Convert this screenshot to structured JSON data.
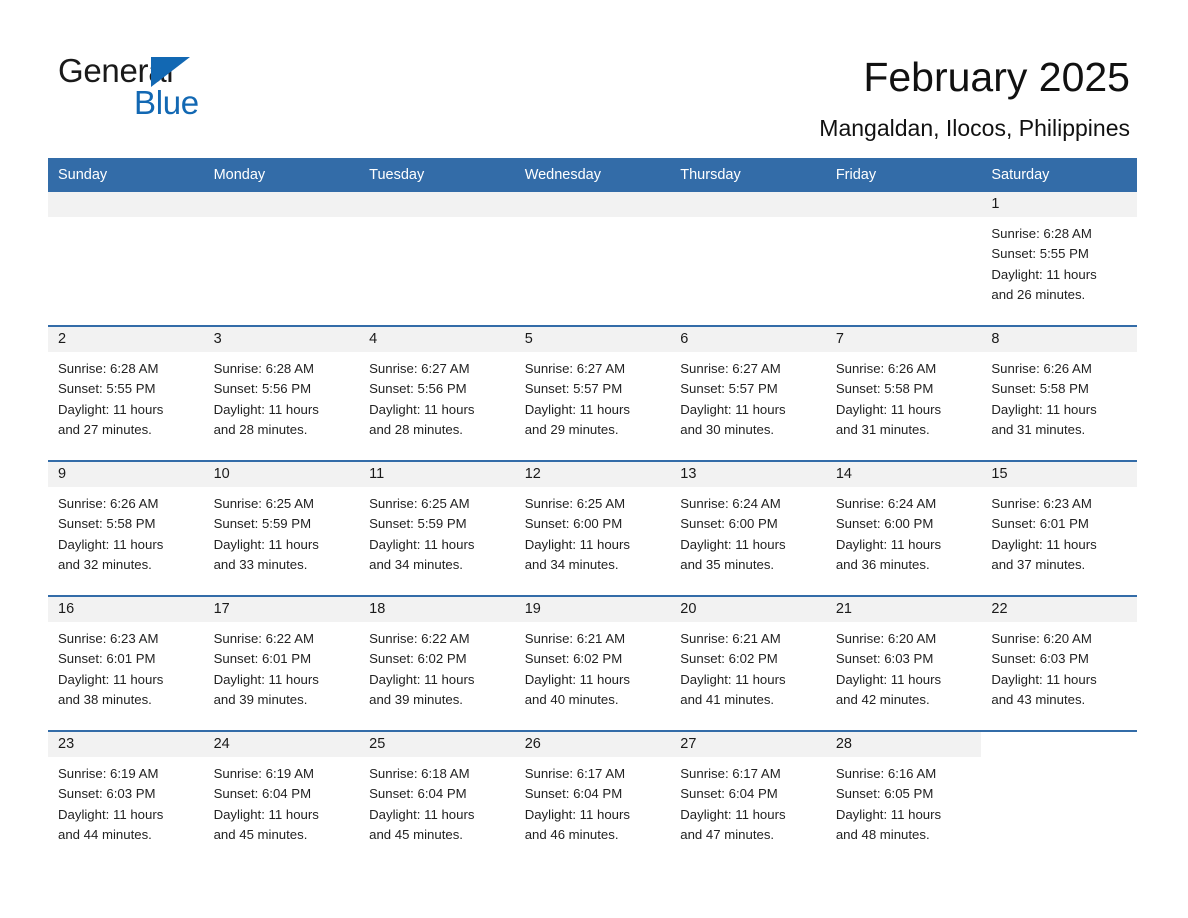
{
  "brand": {
    "name_part1": "General",
    "name_part2": "Blue",
    "accent_color": "#1268b3",
    "triangle_icon": "brand-triangle-icon"
  },
  "header": {
    "title": "February 2025",
    "subtitle": "Mangaldan, Ilocos, Philippines",
    "header_bg_color": "#336ca8"
  },
  "calendar": {
    "weekday_headers": [
      "Sunday",
      "Monday",
      "Tuesday",
      "Wednesday",
      "Thursday",
      "Friday",
      "Saturday"
    ],
    "weeks": [
      [
        {
          "day": "",
          "sunrise": "",
          "sunset": "",
          "daylight1": "",
          "daylight2": ""
        },
        {
          "day": "",
          "sunrise": "",
          "sunset": "",
          "daylight1": "",
          "daylight2": ""
        },
        {
          "day": "",
          "sunrise": "",
          "sunset": "",
          "daylight1": "",
          "daylight2": ""
        },
        {
          "day": "",
          "sunrise": "",
          "sunset": "",
          "daylight1": "",
          "daylight2": ""
        },
        {
          "day": "",
          "sunrise": "",
          "sunset": "",
          "daylight1": "",
          "daylight2": ""
        },
        {
          "day": "",
          "sunrise": "",
          "sunset": "",
          "daylight1": "",
          "daylight2": ""
        },
        {
          "day": "1",
          "sunrise": "Sunrise: 6:28 AM",
          "sunset": "Sunset: 5:55 PM",
          "daylight1": "Daylight: 11 hours",
          "daylight2": "and 26 minutes."
        }
      ],
      [
        {
          "day": "2",
          "sunrise": "Sunrise: 6:28 AM",
          "sunset": "Sunset: 5:55 PM",
          "daylight1": "Daylight: 11 hours",
          "daylight2": "and 27 minutes."
        },
        {
          "day": "3",
          "sunrise": "Sunrise: 6:28 AM",
          "sunset": "Sunset: 5:56 PM",
          "daylight1": "Daylight: 11 hours",
          "daylight2": "and 28 minutes."
        },
        {
          "day": "4",
          "sunrise": "Sunrise: 6:27 AM",
          "sunset": "Sunset: 5:56 PM",
          "daylight1": "Daylight: 11 hours",
          "daylight2": "and 28 minutes."
        },
        {
          "day": "5",
          "sunrise": "Sunrise: 6:27 AM",
          "sunset": "Sunset: 5:57 PM",
          "daylight1": "Daylight: 11 hours",
          "daylight2": "and 29 minutes."
        },
        {
          "day": "6",
          "sunrise": "Sunrise: 6:27 AM",
          "sunset": "Sunset: 5:57 PM",
          "daylight1": "Daylight: 11 hours",
          "daylight2": "and 30 minutes."
        },
        {
          "day": "7",
          "sunrise": "Sunrise: 6:26 AM",
          "sunset": "Sunset: 5:58 PM",
          "daylight1": "Daylight: 11 hours",
          "daylight2": "and 31 minutes."
        },
        {
          "day": "8",
          "sunrise": "Sunrise: 6:26 AM",
          "sunset": "Sunset: 5:58 PM",
          "daylight1": "Daylight: 11 hours",
          "daylight2": "and 31 minutes."
        }
      ],
      [
        {
          "day": "9",
          "sunrise": "Sunrise: 6:26 AM",
          "sunset": "Sunset: 5:58 PM",
          "daylight1": "Daylight: 11 hours",
          "daylight2": "and 32 minutes."
        },
        {
          "day": "10",
          "sunrise": "Sunrise: 6:25 AM",
          "sunset": "Sunset: 5:59 PM",
          "daylight1": "Daylight: 11 hours",
          "daylight2": "and 33 minutes."
        },
        {
          "day": "11",
          "sunrise": "Sunrise: 6:25 AM",
          "sunset": "Sunset: 5:59 PM",
          "daylight1": "Daylight: 11 hours",
          "daylight2": "and 34 minutes."
        },
        {
          "day": "12",
          "sunrise": "Sunrise: 6:25 AM",
          "sunset": "Sunset: 6:00 PM",
          "daylight1": "Daylight: 11 hours",
          "daylight2": "and 34 minutes."
        },
        {
          "day": "13",
          "sunrise": "Sunrise: 6:24 AM",
          "sunset": "Sunset: 6:00 PM",
          "daylight1": "Daylight: 11 hours",
          "daylight2": "and 35 minutes."
        },
        {
          "day": "14",
          "sunrise": "Sunrise: 6:24 AM",
          "sunset": "Sunset: 6:00 PM",
          "daylight1": "Daylight: 11 hours",
          "daylight2": "and 36 minutes."
        },
        {
          "day": "15",
          "sunrise": "Sunrise: 6:23 AM",
          "sunset": "Sunset: 6:01 PM",
          "daylight1": "Daylight: 11 hours",
          "daylight2": "and 37 minutes."
        }
      ],
      [
        {
          "day": "16",
          "sunrise": "Sunrise: 6:23 AM",
          "sunset": "Sunset: 6:01 PM",
          "daylight1": "Daylight: 11 hours",
          "daylight2": "and 38 minutes."
        },
        {
          "day": "17",
          "sunrise": "Sunrise: 6:22 AM",
          "sunset": "Sunset: 6:01 PM",
          "daylight1": "Daylight: 11 hours",
          "daylight2": "and 39 minutes."
        },
        {
          "day": "18",
          "sunrise": "Sunrise: 6:22 AM",
          "sunset": "Sunset: 6:02 PM",
          "daylight1": "Daylight: 11 hours",
          "daylight2": "and 39 minutes."
        },
        {
          "day": "19",
          "sunrise": "Sunrise: 6:21 AM",
          "sunset": "Sunset: 6:02 PM",
          "daylight1": "Daylight: 11 hours",
          "daylight2": "and 40 minutes."
        },
        {
          "day": "20",
          "sunrise": "Sunrise: 6:21 AM",
          "sunset": "Sunset: 6:02 PM",
          "daylight1": "Daylight: 11 hours",
          "daylight2": "and 41 minutes."
        },
        {
          "day": "21",
          "sunrise": "Sunrise: 6:20 AM",
          "sunset": "Sunset: 6:03 PM",
          "daylight1": "Daylight: 11 hours",
          "daylight2": "and 42 minutes."
        },
        {
          "day": "22",
          "sunrise": "Sunrise: 6:20 AM",
          "sunset": "Sunset: 6:03 PM",
          "daylight1": "Daylight: 11 hours",
          "daylight2": "and 43 minutes."
        }
      ],
      [
        {
          "day": "23",
          "sunrise": "Sunrise: 6:19 AM",
          "sunset": "Sunset: 6:03 PM",
          "daylight1": "Daylight: 11 hours",
          "daylight2": "and 44 minutes."
        },
        {
          "day": "24",
          "sunrise": "Sunrise: 6:19 AM",
          "sunset": "Sunset: 6:04 PM",
          "daylight1": "Daylight: 11 hours",
          "daylight2": "and 45 minutes."
        },
        {
          "day": "25",
          "sunrise": "Sunrise: 6:18 AM",
          "sunset": "Sunset: 6:04 PM",
          "daylight1": "Daylight: 11 hours",
          "daylight2": "and 45 minutes."
        },
        {
          "day": "26",
          "sunrise": "Sunrise: 6:17 AM",
          "sunset": "Sunset: 6:04 PM",
          "daylight1": "Daylight: 11 hours",
          "daylight2": "and 46 minutes."
        },
        {
          "day": "27",
          "sunrise": "Sunrise: 6:17 AM",
          "sunset": "Sunset: 6:04 PM",
          "daylight1": "Daylight: 11 hours",
          "daylight2": "and 47 minutes."
        },
        {
          "day": "28",
          "sunrise": "Sunrise: 6:16 AM",
          "sunset": "Sunset: 6:05 PM",
          "daylight1": "Daylight: 11 hours",
          "daylight2": "and 48 minutes."
        },
        {
          "day": "",
          "sunrise": "",
          "sunset": "",
          "daylight1": "",
          "daylight2": ""
        }
      ]
    ]
  }
}
